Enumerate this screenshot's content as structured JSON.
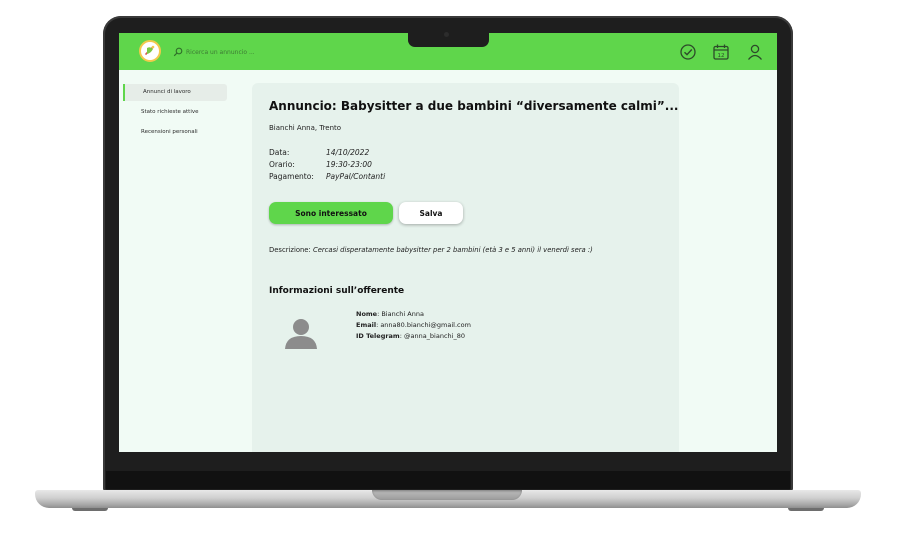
{
  "colors": {
    "accent": "#5fd64b",
    "screen_background": "#f1fbf5",
    "card_background": "#e6f2ec",
    "laptop_bezel": "#1e1e1e"
  },
  "header": {
    "logo_icon": "app-logo-icon",
    "search": {
      "placeholder": "Ricerca un annuncio ..."
    },
    "icons": [
      "check-circle-icon",
      "calendar-icon",
      "user-icon"
    ],
    "calendar_day": "12"
  },
  "sidebar": {
    "items": [
      {
        "label": "Annunci di lavoro",
        "active": true
      },
      {
        "label": "Stato richieste attive",
        "active": false
      },
      {
        "label": "Recensioni personali",
        "active": false
      }
    ]
  },
  "listing": {
    "title": "Annuncio: Babysitter a due bambini “diversamente calmi”...",
    "author_location": "Bianchi Anna, Trento",
    "details": [
      {
        "label": "Data:",
        "value": "14/10/2022"
      },
      {
        "label": "Orario:",
        "value": "19:30-23:00"
      },
      {
        "label": "Pagamento:",
        "value": "PayPal/Contanti"
      }
    ],
    "interested_button": "Sono interessato",
    "save_button": "Salva",
    "description_label": "Descrizione:",
    "description_text": "Cercasi disperatamente babysitter per 2 bambini (età 3 e 5 anni) il venerdì sera :)"
  },
  "offerer": {
    "section_title": "Informazioni sull’offerente",
    "name_label": "Nome",
    "name_value": ": Bianchi Anna",
    "email_label": "Email",
    "email_value": ": anna80.bianchi@gmail.com",
    "telegram_label": "ID Telegram",
    "telegram_value": ": @anna_bianchi_80"
  }
}
